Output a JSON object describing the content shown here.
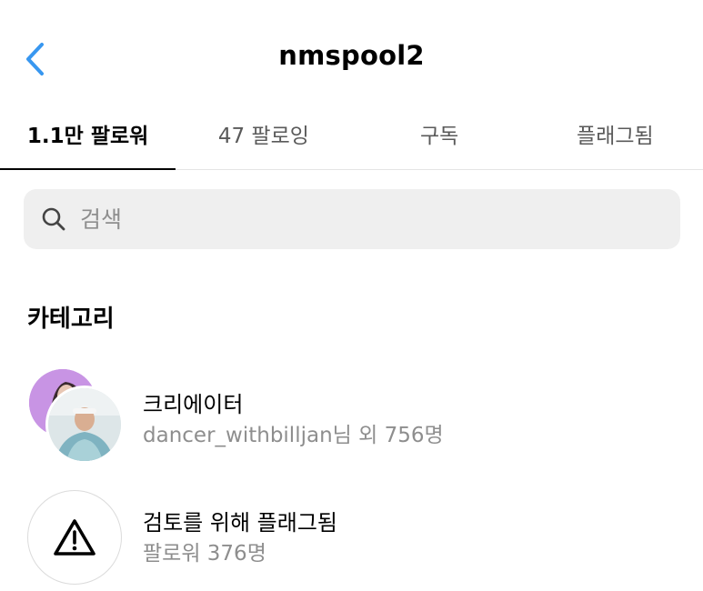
{
  "header": {
    "title": "nmspool2",
    "back_icon": "chevron-left-icon",
    "accent_color": "#3897f0"
  },
  "tabs": [
    {
      "label": "1.1만 팔로워",
      "active": true
    },
    {
      "label": "47 팔로잉",
      "active": false
    },
    {
      "label": "구독",
      "active": false
    },
    {
      "label": "플래그됨",
      "active": false
    }
  ],
  "search": {
    "placeholder": "검색",
    "value": "",
    "icon": "search-icon"
  },
  "categories": {
    "title": "카테고리",
    "items": [
      {
        "title": "크리에이터",
        "subtitle": "dancer_withbilljan님 외 756명",
        "icon": "avatar-stack"
      },
      {
        "title": "검토를 위해 플래그됨",
        "subtitle": "팔로워 376명",
        "icon": "warning-icon"
      }
    ]
  }
}
